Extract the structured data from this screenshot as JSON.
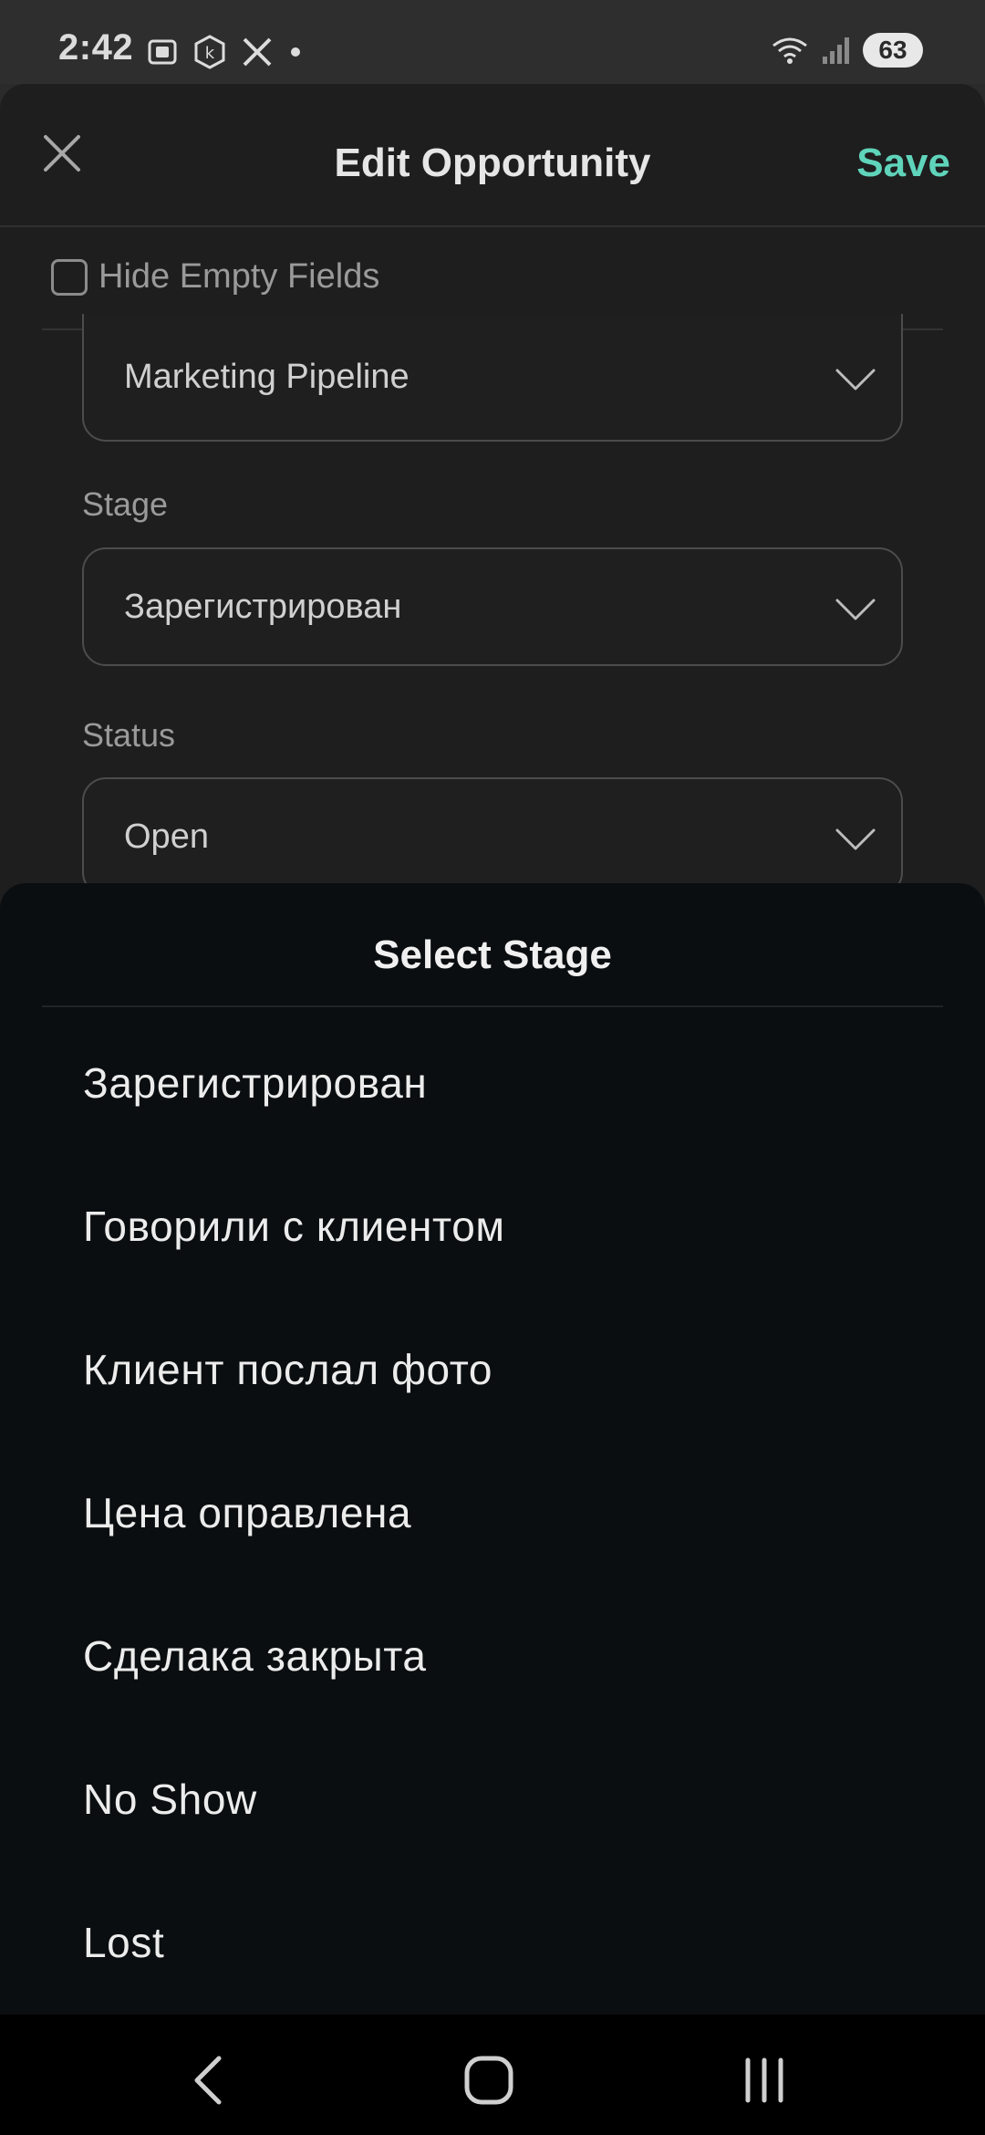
{
  "status_bar": {
    "time": "2:42",
    "battery": "63",
    "left_icons": [
      "screenshot-icon",
      "k-badge-icon",
      "x-logo-icon",
      "dot-icon"
    ],
    "right_icons": [
      "wifi-icon",
      "signal-icon"
    ]
  },
  "edit": {
    "title": "Edit Opportunity",
    "save_label": "Save",
    "hide_empty_label": "Hide Empty Fields",
    "hide_empty_checked": false,
    "pipeline_value": "Marketing Pipeline",
    "stage_label": "Stage",
    "stage_value": "Зарегистрирован",
    "status_label": "Status",
    "status_value": "Open"
  },
  "picker": {
    "title": "Select Stage",
    "items": [
      "Зарегистрирован",
      "Говорили с клиентом",
      "Клиент послал фото",
      "Цена оправлена",
      "Сделака закрыта",
      "No Show",
      "Lost"
    ]
  },
  "colors": {
    "accent": "#5fd4bb",
    "picker_bg": "#0a0e10",
    "sheet_bg": "#1e1e1e"
  }
}
